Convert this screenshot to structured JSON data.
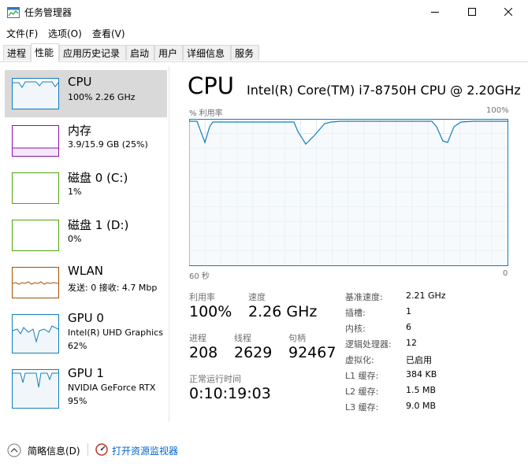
{
  "window": {
    "title": "任务管理器",
    "controls": {
      "minimize": "—",
      "maximize": "☐",
      "close": "✕"
    }
  },
  "menu": [
    "文件(F)",
    "选项(O)",
    "查看(V)"
  ],
  "tabs": [
    {
      "label": "进程",
      "active": false
    },
    {
      "label": "性能",
      "active": true
    },
    {
      "label": "应用历史记录",
      "active": false
    },
    {
      "label": "启动",
      "active": false
    },
    {
      "label": "用户",
      "active": false
    },
    {
      "label": "详细信息",
      "active": false
    },
    {
      "label": "服务",
      "active": false
    }
  ],
  "sidebar": [
    {
      "title": "CPU",
      "line1": "100% 2.26 GHz",
      "line2": "",
      "color": "#117dbb",
      "selected": true
    },
    {
      "title": "内存",
      "line1": "3.9/15.9 GB (25%)",
      "line2": "",
      "color": "#8b12ae",
      "selected": false
    },
    {
      "title": "磁盘 0 (C:)",
      "line1": "1%",
      "line2": "",
      "color": "#4da60c",
      "selected": false
    },
    {
      "title": "磁盘 1 (D:)",
      "line1": "0%",
      "line2": "",
      "color": "#4da60c",
      "selected": false
    },
    {
      "title": "WLAN",
      "line1": "发送: 0 接收: 4.7 Mbp",
      "line2": "",
      "color": "#a74f01",
      "selected": false
    },
    {
      "title": "GPU 0",
      "line1": "Intel(R) UHD Graphics",
      "line2": "62%",
      "color": "#117dbb",
      "selected": false
    },
    {
      "title": "GPU 1",
      "line1": "NVIDIA GeForce RTX",
      "line2": "95%",
      "color": "#117dbb",
      "selected": false
    }
  ],
  "main": {
    "title": "CPU",
    "model": "Intel(R) Core(TM) i7-8750H CPU @ 2.20GHz",
    "graph": {
      "y_label": "% 利用率",
      "y_max_label": "100%",
      "x_left_label": "60 秒",
      "x_right_label": "0",
      "series_color": "#117dbb",
      "fill_color": "#f1f6fa"
    },
    "stats": {
      "utilization": {
        "label": "利用率",
        "value": "100%"
      },
      "speed": {
        "label": "速度",
        "value": "2.26 GHz"
      },
      "processes": {
        "label": "进程",
        "value": "208"
      },
      "threads": {
        "label": "线程",
        "value": "2629"
      },
      "handles": {
        "label": "句柄",
        "value": "92467"
      },
      "uptime": {
        "label": "正常运行时间",
        "value": "0:10:19:03"
      }
    },
    "specs": [
      {
        "label": "基准速度:",
        "value": "2.21 GHz"
      },
      {
        "label": "插槽:",
        "value": "1"
      },
      {
        "label": "内核:",
        "value": "6"
      },
      {
        "label": "逻辑处理器:",
        "value": "12"
      },
      {
        "label": "虚拟化:",
        "value": "已启用"
      },
      {
        "label": "L1 缓存:",
        "value": "384 KB"
      },
      {
        "label": "L2 缓存:",
        "value": "1.5 MB"
      },
      {
        "label": "L3 缓存:",
        "value": "9.0 MB"
      }
    ]
  },
  "footer": {
    "brief": "简略信息(D)",
    "monitor": "打开资源监视器"
  }
}
